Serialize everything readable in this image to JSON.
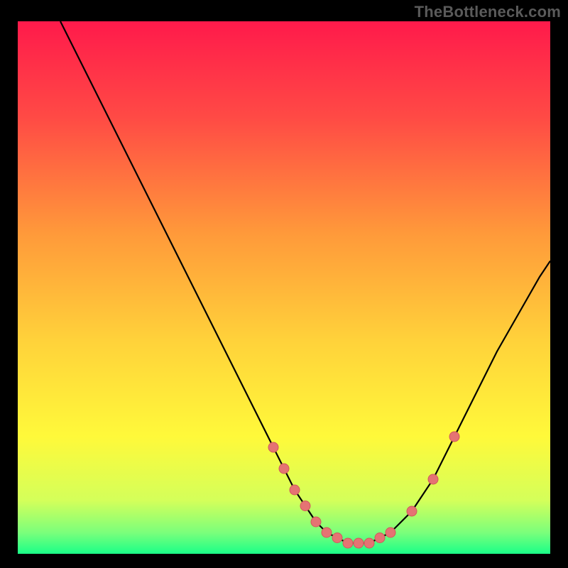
{
  "watermark": "TheBottleneck.com",
  "colors": {
    "gradient": [
      "#ff1a4b",
      "#ff4a45",
      "#ff9a3a",
      "#ffd23a",
      "#fff93a",
      "#d4ff5a",
      "#7bff7b",
      "#1aff88"
    ],
    "gradient_stops_pct": [
      0,
      18,
      40,
      60,
      78,
      90,
      96,
      100
    ],
    "curve": "#000000",
    "dot_fill": "#e57373",
    "dot_stroke": "#d05a5a"
  },
  "chart_data": {
    "type": "line",
    "title": "",
    "xlabel": "",
    "ylabel": "",
    "xlim": [
      0,
      100
    ],
    "ylim": [
      0,
      100
    ],
    "series": [
      {
        "name": "bottleneck-curve",
        "x": [
          8,
          12,
          16,
          20,
          24,
          28,
          32,
          36,
          40,
          44,
          48,
          50,
          52,
          54,
          56,
          58,
          60,
          62,
          64,
          66,
          68,
          70,
          74,
          78,
          82,
          86,
          90,
          94,
          98,
          100
        ],
        "y": [
          100,
          92,
          84,
          76,
          68,
          60,
          52,
          44,
          36,
          28,
          20,
          16,
          12,
          9,
          6,
          4,
          3,
          2,
          2,
          2,
          3,
          4,
          8,
          14,
          22,
          30,
          38,
          45,
          52,
          55
        ]
      }
    ],
    "dots": {
      "name": "highlighted-points",
      "x": [
        48,
        50,
        52,
        54,
        56,
        58,
        60,
        62,
        64,
        66,
        68,
        70,
        74,
        78,
        82
      ],
      "y": [
        20,
        16,
        12,
        9,
        6,
        4,
        3,
        2,
        2,
        2,
        3,
        4,
        8,
        14,
        22
      ]
    }
  }
}
